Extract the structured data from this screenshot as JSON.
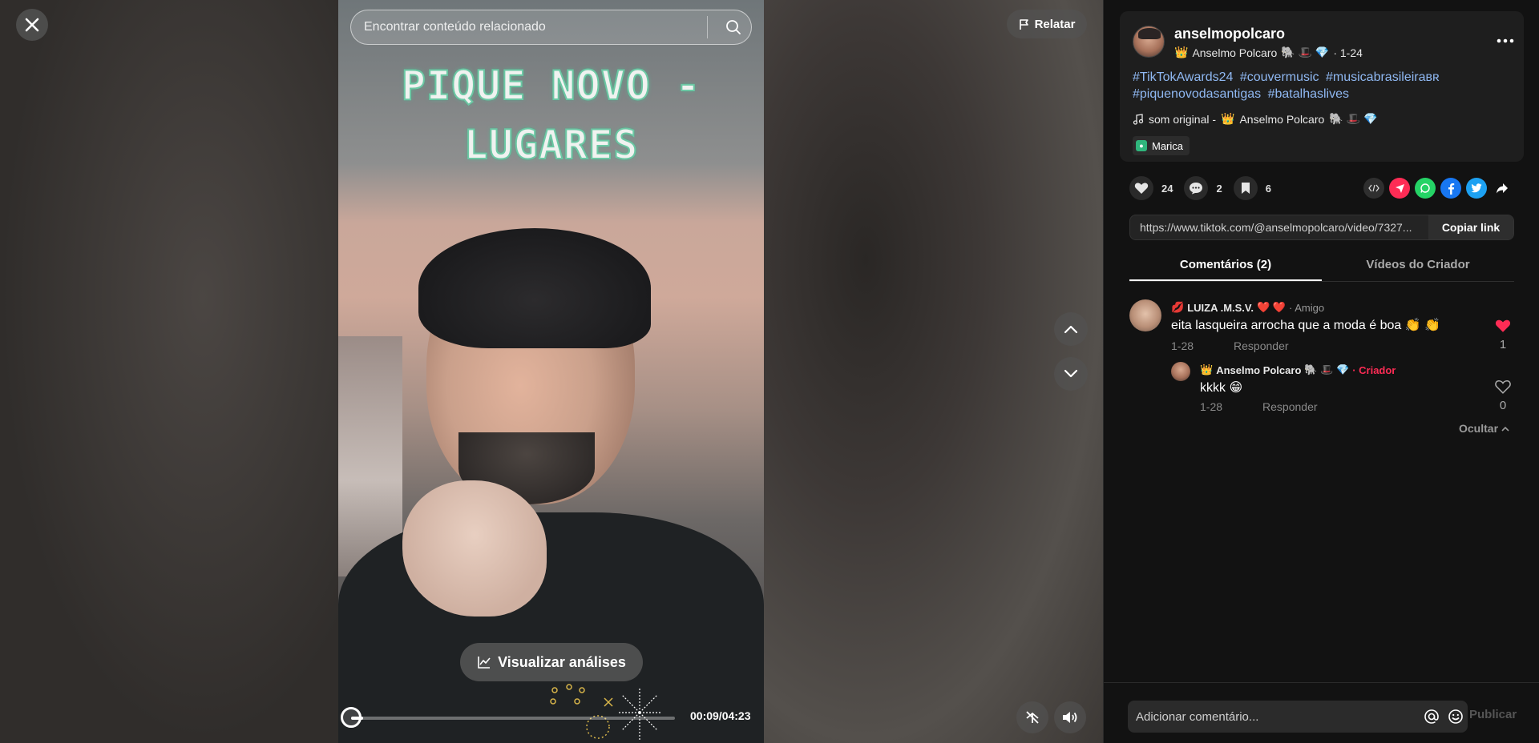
{
  "search": {
    "placeholder": "Encontrar conteúdo relacionado"
  },
  "report": {
    "label": "Relatar"
  },
  "video": {
    "title_line1": "PIQUE NOVO  -",
    "title_line2": "LUGARES",
    "analytics_label": "Visualizar análises",
    "time": "00:09/04:23",
    "progress": 0.036
  },
  "author": {
    "username": "anselmopolcaro",
    "display_name": "Anselmo Polcaro",
    "badges": "🐘 🎩 💎",
    "crown": "👑",
    "date": "· 1-24"
  },
  "post": {
    "hashtags": [
      "#TikTokAwards24",
      "#couvermusic",
      "#musicabrasileiraʙʀ",
      "#piquenovodasantigas",
      "#batalhaslives"
    ],
    "sound_prefix": "som original -",
    "sound_author": "Anselmo Polcaro",
    "location": "Marica"
  },
  "stats": {
    "likes": "24",
    "comments": "2",
    "saves": "6"
  },
  "share_icons": [
    "embed-icon",
    "send-icon",
    "whatsapp-icon",
    "facebook-icon",
    "twitter-icon",
    "share-icon"
  ],
  "link": {
    "url": "https://www.tiktok.com/@anselmopolcaro/video/7327...",
    "copy_label": "Copiar link"
  },
  "tabs": [
    {
      "label": "Comentários (2)",
      "active": true
    },
    {
      "label": "Vídeos do Criador",
      "active": false
    }
  ],
  "comments": [
    {
      "name": "LUIZA .M.S.V.",
      "name_prefix": "💋",
      "name_suffix": "❤️ ❤️",
      "tag": "· Amigo",
      "text": "eita lasqueira arrocha que a moda é boa 👏 👏",
      "date": "1-28",
      "reply_label": "Responder",
      "likes": "1",
      "liked": true
    },
    {
      "name": "Anselmo Polcaro",
      "name_prefix": "👑",
      "name_suffix": "🐘 🎩 💎",
      "tag": "· Criador",
      "text": "kkkk 😁",
      "date": "1-28",
      "reply_label": "Responder",
      "likes": "0",
      "liked": false
    }
  ],
  "hide_label": "Ocultar",
  "comment_box": {
    "placeholder": "Adicionar comentário...",
    "publish_label": "Publicar"
  },
  "colors": {
    "accent": "#fe2c55",
    "hashtag": "#8fb8f2",
    "panel": "#121212"
  }
}
